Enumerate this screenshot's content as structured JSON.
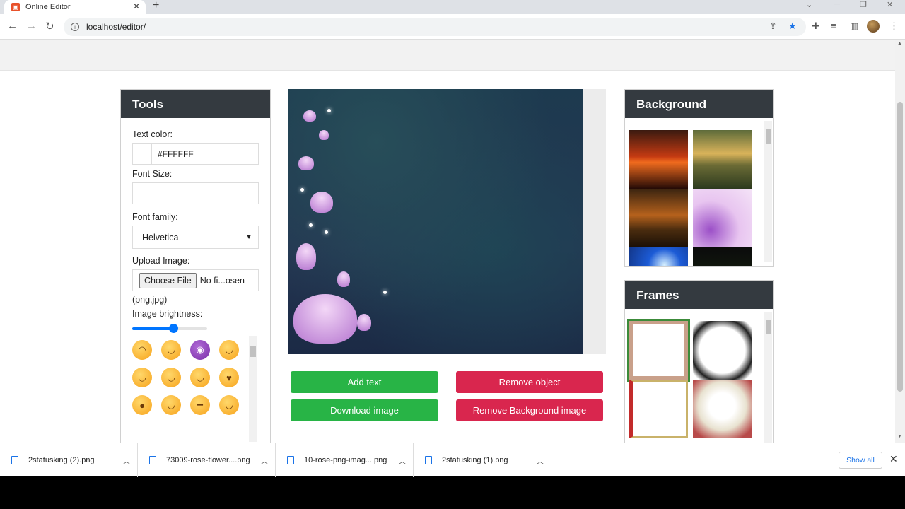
{
  "browser": {
    "tab_title": "Online Editor",
    "url": "localhost/editor/",
    "new_tab": "+",
    "close_tab": "✕"
  },
  "tools": {
    "title": "Tools",
    "text_color_label": "Text color:",
    "text_color_value": "#FFFFFF",
    "font_size_label": "Font Size:",
    "font_size_value": "",
    "font_family_label": "Font family:",
    "font_family_value": "Helvetica",
    "upload_label": "Upload Image:",
    "choose_file": "Choose File",
    "no_file": "No fi...osen",
    "file_types": "(png,jpg)",
    "brightness_label": "Image brightness:",
    "brightness_value": 0.55
  },
  "actions": {
    "add_text": "Add text",
    "remove_object": "Remove object",
    "download_image": "Download image",
    "remove_background": "Remove Background image"
  },
  "background_panel": {
    "title": "Background"
  },
  "frames_panel": {
    "title": "Frames"
  },
  "downloads": {
    "items": [
      "2statusking (2).png",
      "73009-rose-flower....png",
      "10-rose-png-imag....png",
      "2statusking (1).png"
    ],
    "show_all": "Show all"
  },
  "colors": {
    "accent_green": "#28b446",
    "accent_red": "#d9264e",
    "header_dark": "#343a40"
  }
}
